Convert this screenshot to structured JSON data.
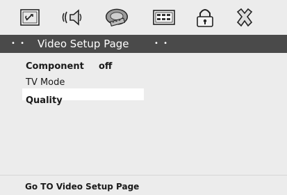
{
  "icons": [
    {
      "name": "general-setup-icon"
    },
    {
      "name": "audio-setup-icon"
    },
    {
      "name": "video-setup-icon"
    },
    {
      "name": "preference-icon"
    },
    {
      "name": "password-lock-icon"
    },
    {
      "name": "exit-icon"
    }
  ],
  "header": {
    "dots_left": "• •",
    "title": "Video Setup Page",
    "dots_right": "• •"
  },
  "menu": {
    "items": [
      {
        "label": "Component",
        "value": "off"
      },
      {
        "label": "TV Mode"
      },
      {
        "label": "Quality"
      }
    ]
  },
  "status": {
    "text": "Go TO Video Setup Page"
  },
  "colors": {
    "background": "#ececec",
    "header_bg": "#4a4a4a",
    "header_text": "#ffffff",
    "highlight": "#ffffff"
  }
}
